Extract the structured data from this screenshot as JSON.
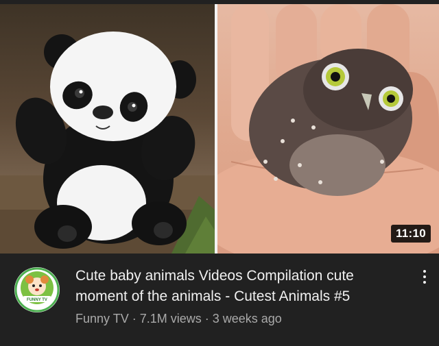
{
  "video": {
    "duration": "11:10",
    "title": "Cute baby animals Videos Compilation cute moment of the animals - Cutest Animals #5",
    "channel_name": "Funny TV",
    "views": "7.1M views",
    "age": "3 weeks ago",
    "separator": "·"
  },
  "avatar": {
    "logo_text": "FUNNY TV"
  },
  "icons": {
    "more": "more-vert-icon",
    "avatar": "channel-avatar-icon"
  },
  "colors": {
    "background": "#212121",
    "title": "#f1f1f1",
    "meta": "#aaaaaa",
    "avatar_ring": "#4caf50"
  }
}
